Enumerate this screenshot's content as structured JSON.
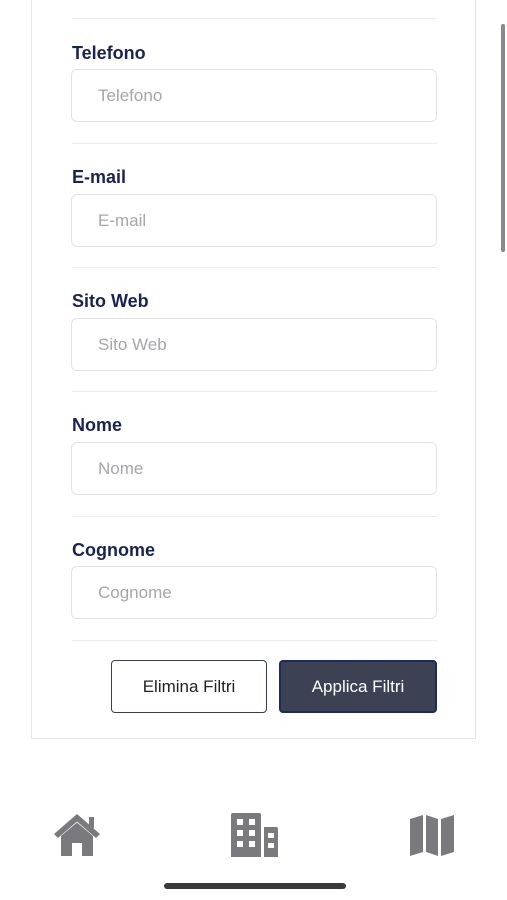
{
  "filters": {
    "fields": [
      {
        "label": "Telefono",
        "placeholder": "Telefono",
        "value": ""
      },
      {
        "label": "E-mail",
        "placeholder": "E-mail",
        "value": ""
      },
      {
        "label": "Sito Web",
        "placeholder": "Sito Web",
        "value": ""
      },
      {
        "label": "Nome",
        "placeholder": "Nome",
        "value": ""
      },
      {
        "label": "Cognome",
        "placeholder": "Cognome",
        "value": ""
      }
    ],
    "clear_label": "Elimina Filtri",
    "apply_label": "Applica Filtri"
  },
  "tab_bar": {
    "items": [
      {
        "icon": "home-icon"
      },
      {
        "icon": "building-icon"
      },
      {
        "icon": "map-icon"
      }
    ]
  },
  "colors": {
    "label": "#1b2353",
    "placeholder": "#a6a6ab",
    "apply_bg": "#3d4154",
    "apply_border": "#1c2a5e",
    "tab_icon": "#7a7a7e"
  }
}
